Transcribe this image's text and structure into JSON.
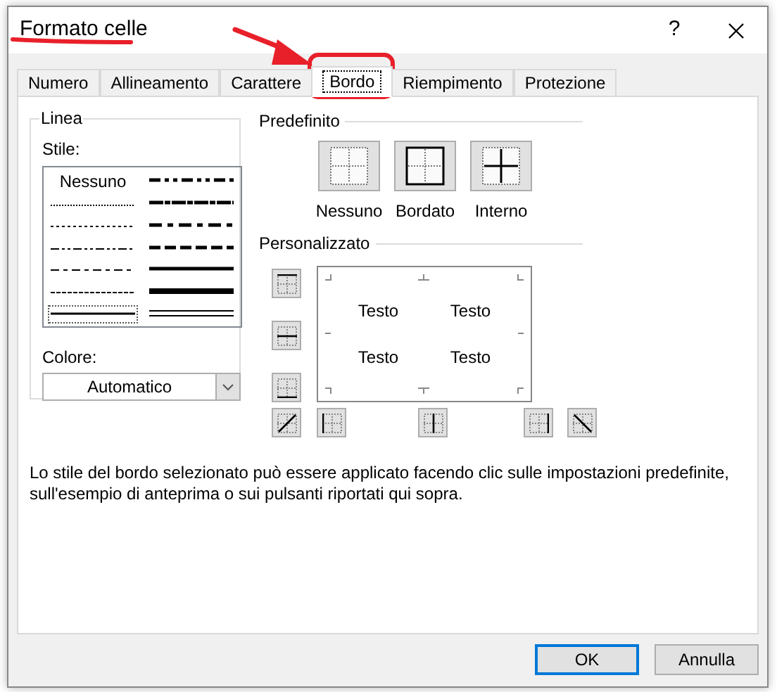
{
  "window": {
    "title": "Formato celle",
    "help": "?"
  },
  "tabs": [
    {
      "label": "Numero",
      "selected": false
    },
    {
      "label": "Allineamento",
      "selected": false
    },
    {
      "label": "Carattere",
      "selected": false
    },
    {
      "label": "Bordo",
      "selected": true
    },
    {
      "label": "Riempimento",
      "selected": false
    },
    {
      "label": "Protezione",
      "selected": false
    }
  ],
  "line_group": {
    "title": "Linea",
    "style_label": "Stile:",
    "styles": [
      {
        "kind": "none",
        "label": "Nessuno",
        "selected": false
      },
      {
        "kind": "hair",
        "selected": false
      },
      {
        "kind": "dotted",
        "selected": false
      },
      {
        "kind": "dash-dot-dot",
        "selected": false
      },
      {
        "kind": "dash-dot",
        "selected": false
      },
      {
        "kind": "dashed",
        "selected": false
      },
      {
        "kind": "thin",
        "selected": true
      },
      {
        "kind": "medium-dash-dot-dot",
        "selected": false
      },
      {
        "kind": "slant-dash-dot",
        "selected": false
      },
      {
        "kind": "medium-dash-dot",
        "selected": false
      },
      {
        "kind": "medium-dashed",
        "selected": false
      },
      {
        "kind": "medium",
        "selected": false
      },
      {
        "kind": "thick",
        "selected": false
      },
      {
        "kind": "double",
        "selected": false
      }
    ],
    "color_label": "Colore:",
    "color_value": "Automatico"
  },
  "presets": {
    "title": "Predefinito",
    "items": [
      {
        "kind": "none",
        "label": "Nessuno"
      },
      {
        "kind": "outline",
        "label": "Bordato"
      },
      {
        "kind": "inside",
        "label": "Interno"
      }
    ]
  },
  "custom": {
    "title": "Personalizzato",
    "side_buttons": [
      {
        "kind": "top"
      },
      {
        "kind": "middle"
      },
      {
        "kind": "bottom"
      }
    ],
    "bottom_buttons": [
      {
        "kind": "diag-up"
      },
      {
        "kind": "left"
      },
      {
        "kind": "center"
      },
      {
        "kind": "right"
      },
      {
        "kind": "diag-down"
      }
    ],
    "preview_texts": [
      "Testo",
      "Testo",
      "Testo",
      "Testo"
    ]
  },
  "description": "Lo stile del bordo selezionato può essere applicato facendo clic sulle impostazioni predefinite, sull'esempio di anteprima o sui pulsanti riportati qui sopra.",
  "buttons": [
    {
      "label": "OK",
      "kind": "default"
    },
    {
      "label": "Annulla",
      "kind": "normal"
    }
  ],
  "annotations": [
    {
      "kind": "underline"
    },
    {
      "kind": "arrow"
    },
    {
      "kind": "frame"
    }
  ]
}
